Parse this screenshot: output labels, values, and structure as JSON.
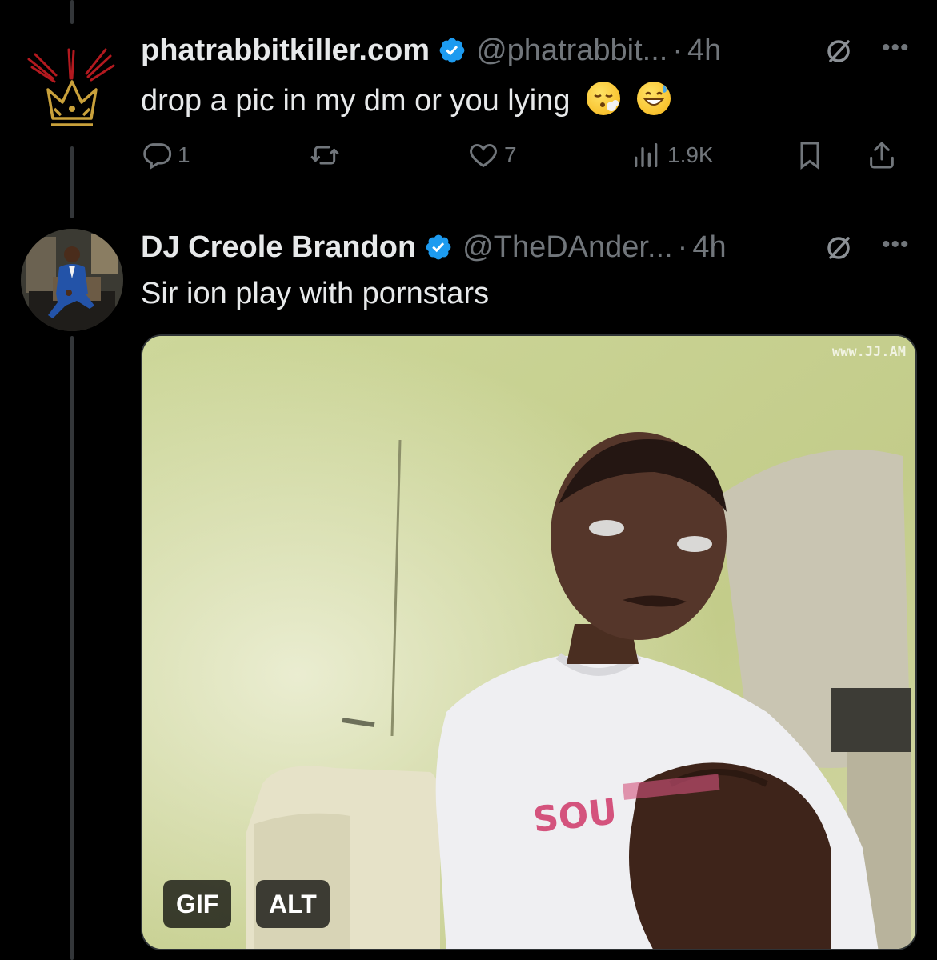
{
  "tweets": [
    {
      "display_name": "phatrabbitkiller.com",
      "handle": "@phatrabbit...",
      "separator": "·",
      "time": "4h",
      "text": "drop a pic in my dm or you lying",
      "emojis": [
        "face-exhaling-emoji",
        "grinning-sweat-emoji"
      ],
      "reply_count": "1",
      "retweet_count": "",
      "like_count": "7",
      "view_count": "1.9K"
    },
    {
      "display_name": "DJ Creole Brandon",
      "handle": "@TheDAnder...",
      "separator": "·",
      "time": "4h",
      "text": "Sir ion play with pornstars",
      "media": {
        "watermark": "www.JJ.AM",
        "shirt_text": "SOU",
        "gif_label": "GIF",
        "alt_label": "ALT"
      }
    }
  ],
  "colors": {
    "background": "#000000",
    "text_primary": "#e7e9ea",
    "text_secondary": "#71767b",
    "verified": "#1d9bf0",
    "thread_line": "#333639"
  }
}
